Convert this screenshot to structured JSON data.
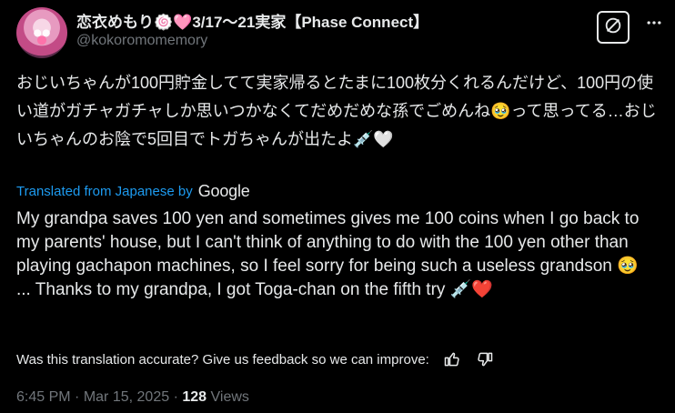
{
  "author": {
    "display_name": "恋衣めもり🍥🩷3/17〜21実家【Phase Connect】",
    "handle": "@kokoromomemory"
  },
  "post": {
    "original_text": "おじいちゃんが100円貯金してて実家帰るとたまに100枚分くれるんだけど、100円の使い道がガチャガチャしか思いつかなくてだめだめな孫でごめんね🥹って思ってる…おじいちゃんのお陰で5回目でトガちゃんが出たよ💉🤍",
    "translated_label": "Translated from Japanese by",
    "translator": "Google",
    "translated_text": "My grandpa saves 100 yen and sometimes gives me 100 coins when I go back to my parents' house, but I can't think of anything to do with the 100 yen other than playing gachapon machines, so I feel sorry for being such a useless grandson 🥹 ... Thanks to my grandpa, I got Toga-chan on the fifth try 💉❤️"
  },
  "feedback": {
    "prompt": "Was this translation accurate? Give us feedback so we can improve:"
  },
  "meta": {
    "time": "6:45 PM",
    "separator": "·",
    "date": "Mar 15, 2025",
    "views_count": "128",
    "views_label": "Views"
  },
  "icons": {
    "grok": "grok-icon",
    "more": "more-icon",
    "thumbs_up": "thumbs-up-icon",
    "thumbs_down": "thumbs-down-icon"
  },
  "colors": {
    "background": "#000000",
    "text": "#e7e9ea",
    "muted": "#71767b",
    "link": "#1d9bf0"
  }
}
